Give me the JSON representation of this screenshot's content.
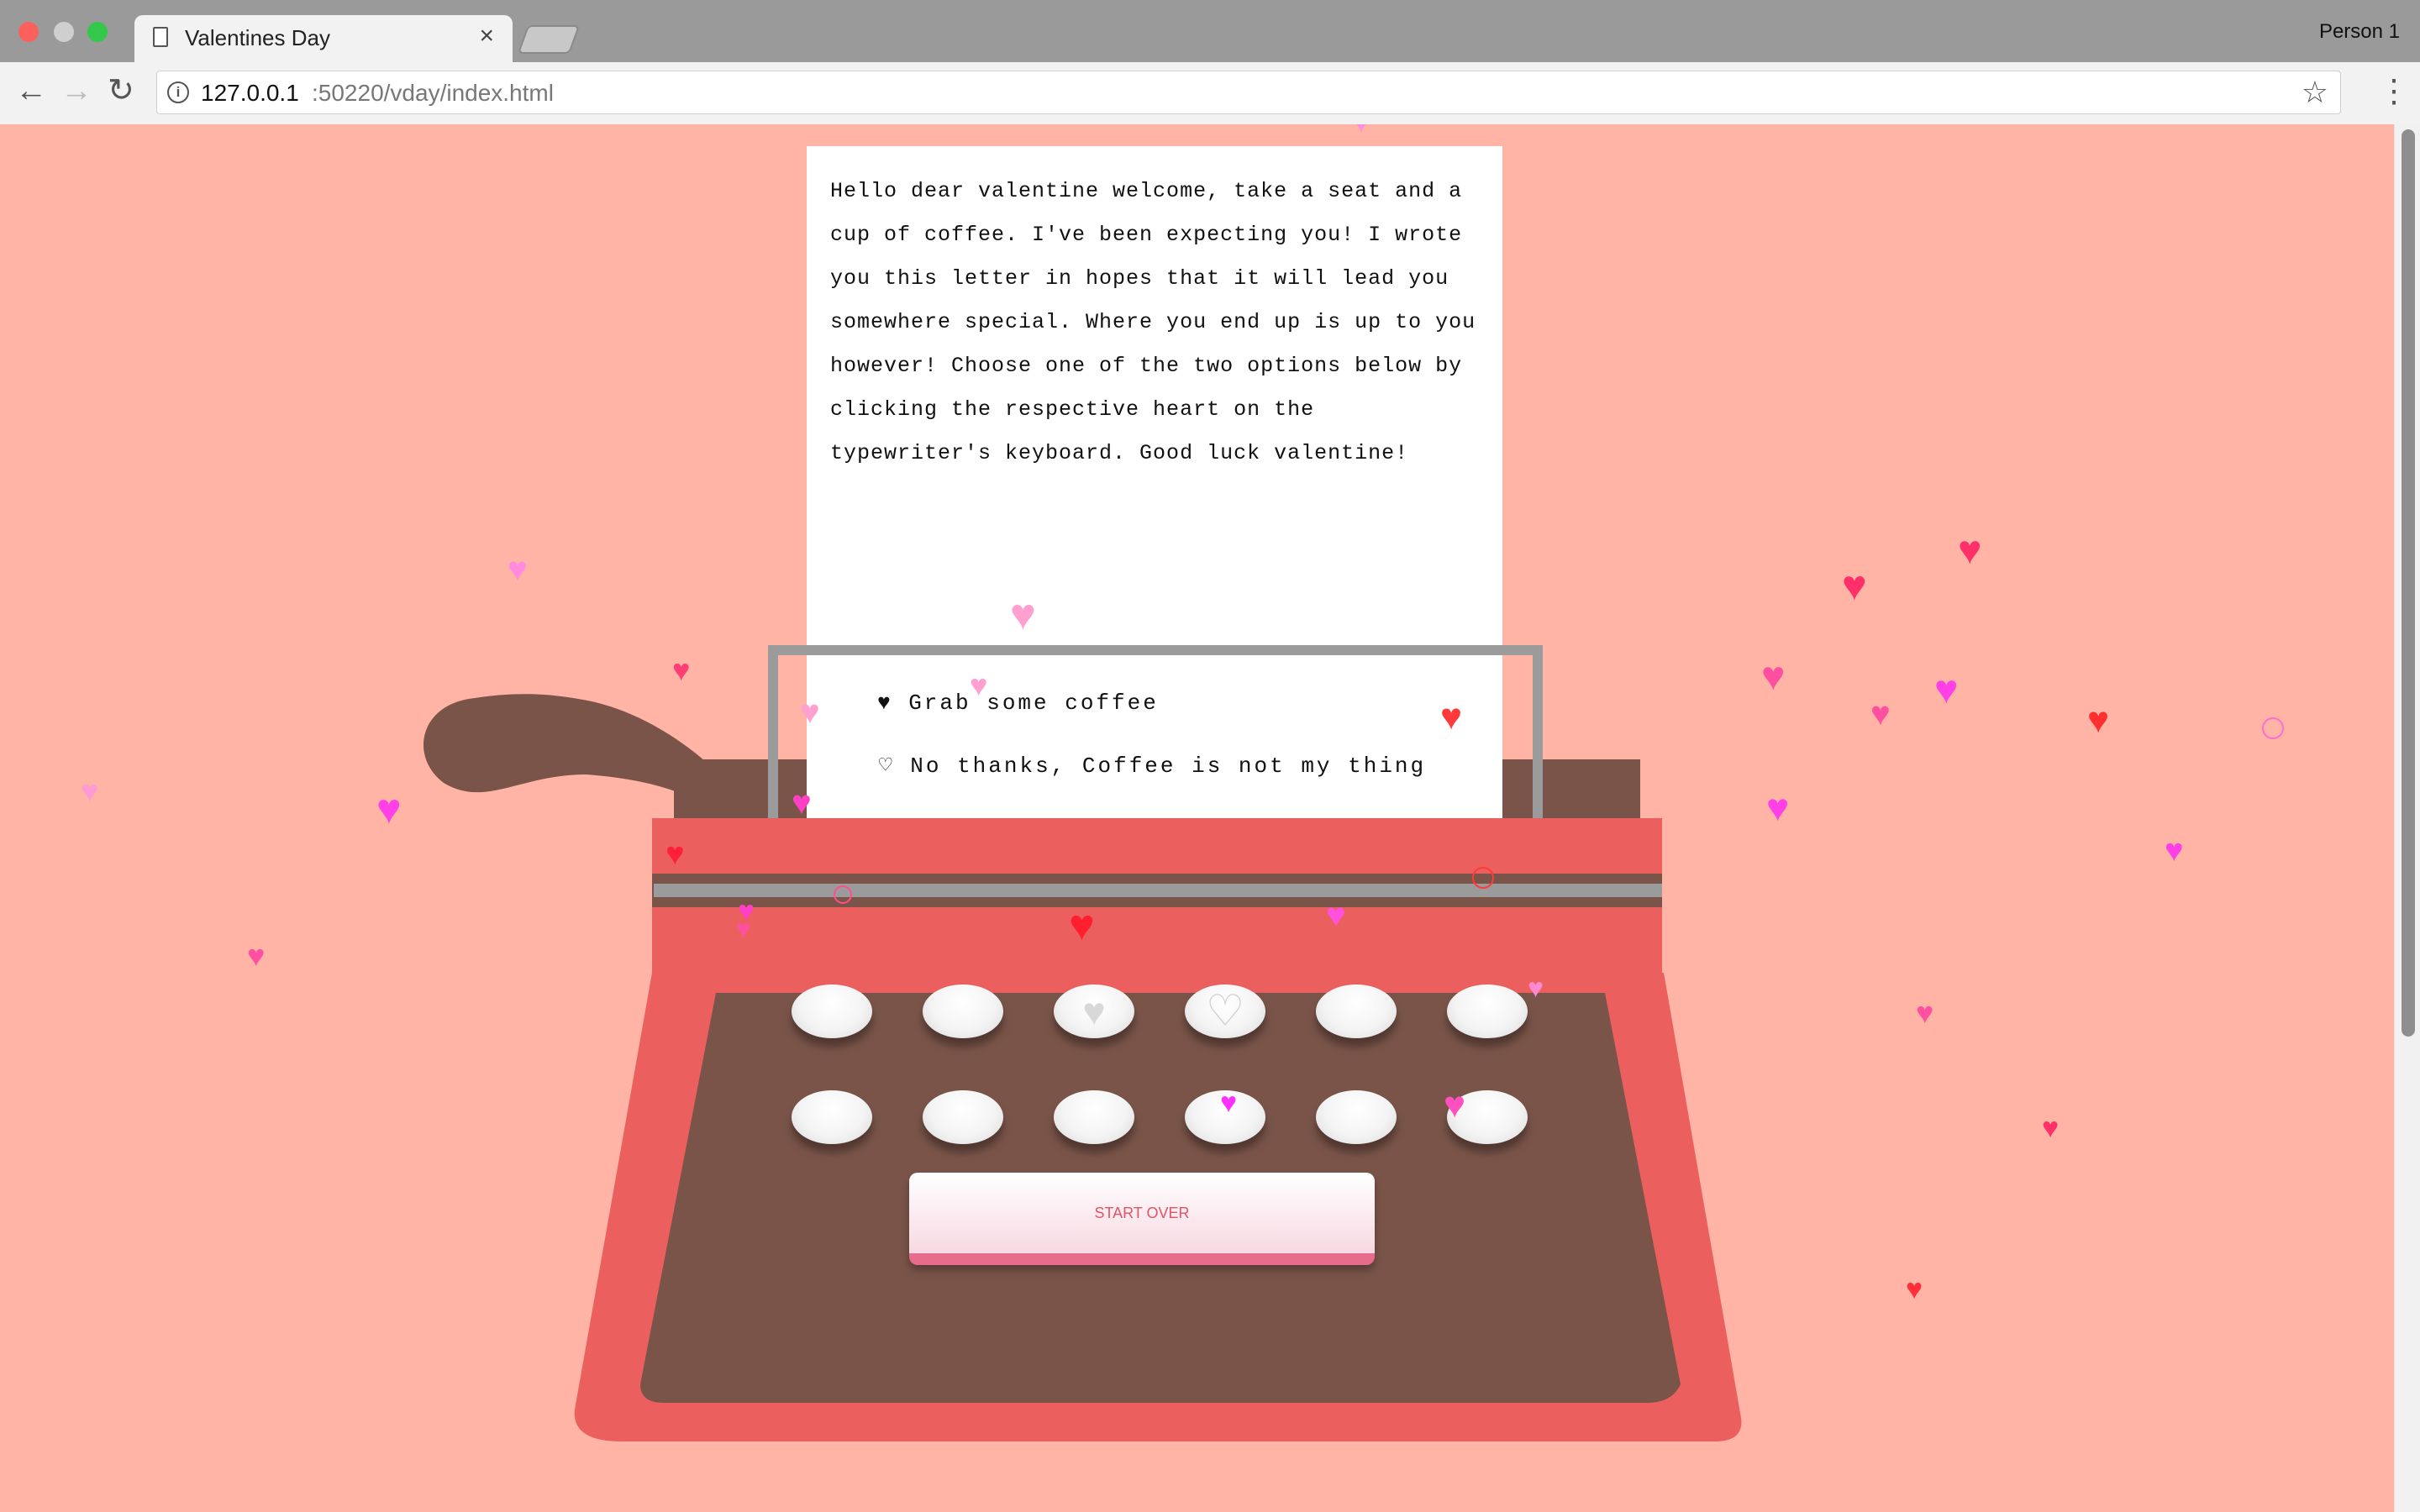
{
  "browser": {
    "tab_title": "Valentines Day",
    "tab_close": "×",
    "profile_name": "Person 1",
    "url_host": "127.0.0.1",
    "url_path": ":50220/vday/index.html",
    "info_icon": "i",
    "back_icon": "←",
    "forward_icon": "→",
    "reload_icon": "↻",
    "star_icon": "☆",
    "menu_icon": "⋮"
  },
  "letter": {
    "body": "Hello dear valentine welcome, take a seat and a cup of coffee. I've been expecting you! I wrote you this letter in hopes that it will lead you somewhere special. Where you end up is up to you however! Choose one of the two options below by clicking the respective heart on the typewriter's keyboard. Good luck valentine!"
  },
  "options": {
    "yes": "♥ Grab some coffee",
    "no": "♡ No thanks, Coffee is not my thing"
  },
  "keyboard": {
    "yes_key_icon": "♥",
    "no_key_icon": "♡",
    "start_over_label": "START OVER"
  },
  "colors": {
    "background": "#ffb4a5",
    "typewriter_red": "#ec5f5f",
    "typewriter_brown": "#7a5449",
    "rail_gray": "#9b9b9b",
    "button_accent": "#e76c8b"
  }
}
